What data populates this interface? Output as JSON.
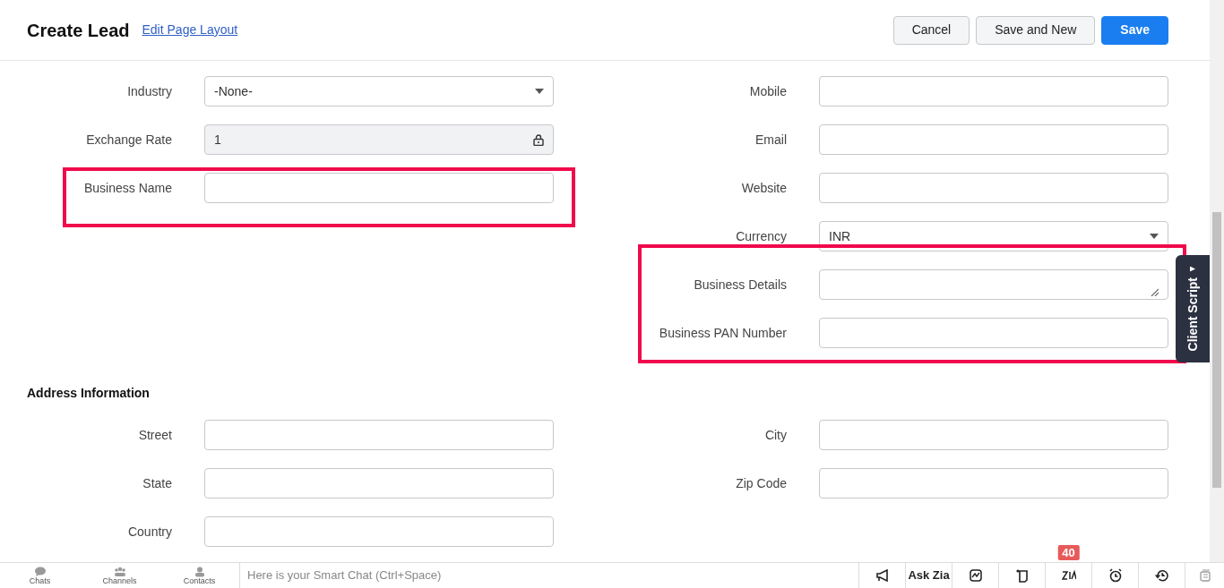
{
  "header": {
    "title": "Create Lead",
    "link": "Edit Page Layout",
    "buttons": [
      {
        "label": "Cancel",
        "kind": "secondary"
      },
      {
        "label": "Save and New",
        "kind": "secondary"
      },
      {
        "label": "Save",
        "kind": "primary"
      }
    ]
  },
  "sections": [
    {
      "left": [
        {
          "label": "Industry",
          "kind": "select",
          "value": "-None-"
        },
        {
          "label": "Exchange Rate",
          "kind": "locked",
          "value": "1"
        },
        {
          "label": "Business Name",
          "kind": "text",
          "highlighted": true
        }
      ],
      "right": [
        {
          "label": "Mobile",
          "kind": "text"
        },
        {
          "label": "Email",
          "kind": "text"
        },
        {
          "label": "Website",
          "kind": "text"
        },
        {
          "label": "Currency",
          "kind": "select",
          "value": "INR"
        },
        {
          "label": "Business Details",
          "kind": "textarea",
          "highlighted": true
        },
        {
          "label": "Business PAN Number",
          "kind": "text",
          "highlighted": true
        }
      ]
    },
    {
      "title": "Address Information",
      "left": [
        {
          "label": "Street",
          "kind": "text"
        },
        {
          "label": "State",
          "kind": "text"
        },
        {
          "label": "Country",
          "kind": "text"
        }
      ],
      "right": [
        {
          "label": "City",
          "kind": "text"
        },
        {
          "label": "Zip Code",
          "kind": "text"
        }
      ]
    }
  ],
  "side_tab": {
    "label": "Client Script"
  },
  "bottom_bar": {
    "left": [
      {
        "label": "Chats",
        "kind": "chat"
      },
      {
        "label": "Channels",
        "kind": "group"
      },
      {
        "label": "Contacts",
        "kind": "person"
      }
    ],
    "chat_placeholder": "Here is your Smart Chat (Ctrl+Space)",
    "right": [
      {
        "kind": "megaphone"
      },
      {
        "kind": "text",
        "label": "Ask Zia"
      },
      {
        "kind": "chart"
      },
      {
        "kind": "note"
      },
      {
        "kind": "zia",
        "badge": "40"
      },
      {
        "kind": "alarm"
      },
      {
        "kind": "history"
      }
    ]
  }
}
